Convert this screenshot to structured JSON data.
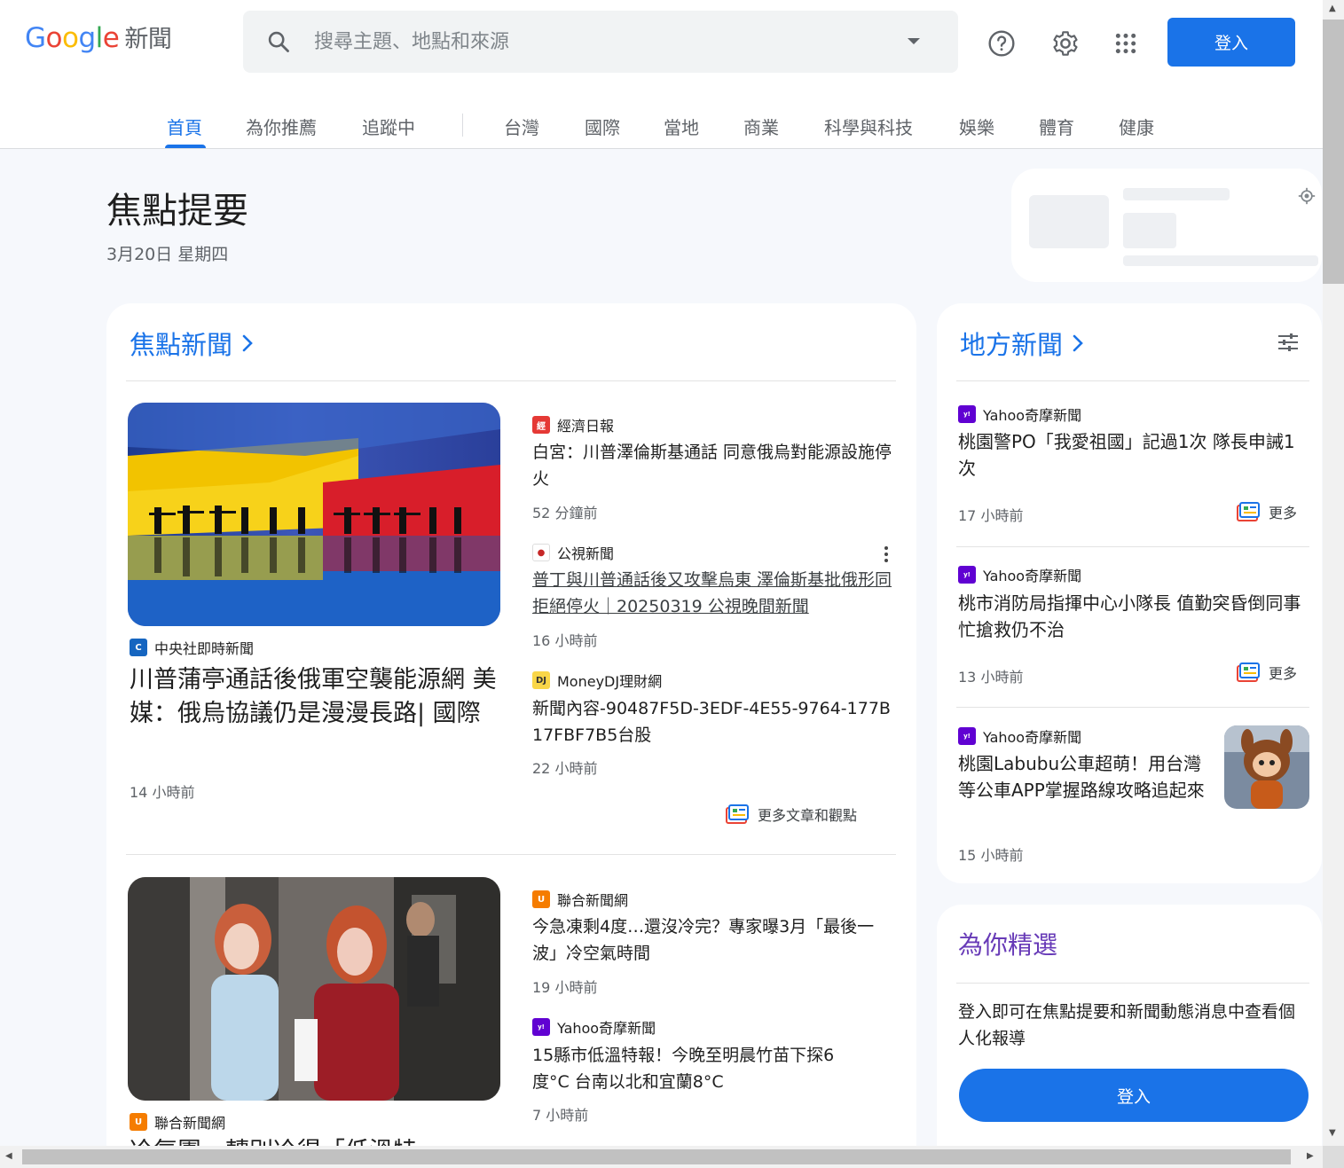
{
  "header": {
    "logo_letters": [
      "G",
      "o",
      "o",
      "g",
      "l",
      "e"
    ],
    "logo_suffix": "新聞",
    "search_placeholder": "搜尋主題、地點和來源",
    "login_label": "登入"
  },
  "nav": {
    "items": [
      {
        "label": "首頁",
        "active": true
      },
      {
        "label": "為你推薦"
      },
      {
        "label": "追蹤中"
      },
      {
        "label": "台灣"
      },
      {
        "label": "國際"
      },
      {
        "label": "當地"
      },
      {
        "label": "商業"
      },
      {
        "label": "科學與科技"
      },
      {
        "label": "娛樂"
      },
      {
        "label": "體育"
      },
      {
        "label": "健康"
      }
    ]
  },
  "briefing": {
    "title": "焦點提要",
    "date": "3月20日 星期四"
  },
  "top_stories": {
    "section_label": "焦點新聞",
    "cluster1": {
      "hero": {
        "source": "中央社即時新聞",
        "headline": "川普蒲亭通話後俄軍空襲能源網 美媒：俄烏協議仍是漫漫長路| 國際",
        "time": "14 小時前"
      },
      "articles": [
        {
          "source": "經濟日報",
          "headline": "白宮：川普澤倫斯基通話 同意俄烏對能源設施停火",
          "time": "52 分鐘前"
        },
        {
          "source": "公視新聞",
          "headline": "普丁與川普通話後又攻擊烏東 澤倫斯基批俄形同拒絕停火｜20250319 公視晚間新聞",
          "time": "16 小時前"
        },
        {
          "source": "MoneyDJ理財網",
          "headline": "新聞內容-90487F5D-3EDF-4E55-9764-177B17FBF7B5台股",
          "time": "22 小時前"
        }
      ],
      "more_label": "更多文章和觀點"
    },
    "cluster2": {
      "hero": {
        "source": "聯合新聞網",
        "headline": "冷氣團一轉別冷得「低溫特"
      },
      "articles": [
        {
          "source": "聯合新聞網",
          "headline": "今急凍剩4度…還沒冷完？專家曝3月「最後一波」冷空氣時間",
          "time": "19 小時前"
        },
        {
          "source": "Yahoo奇摩新聞",
          "headline": "15縣市低溫特報！今晚至明晨竹苗下探6度°C 台南以北和宜蘭8°C",
          "time": "7 小時前"
        }
      ]
    }
  },
  "local_news": {
    "section_label": "地方新聞",
    "items": [
      {
        "source": "Yahoo奇摩新聞",
        "headline": "桃園警PO「我愛祖國」記過1次 隊長申誡1次",
        "time": "17 小時前",
        "more_label": "更多"
      },
      {
        "source": "Yahoo奇摩新聞",
        "headline": "桃市消防局指揮中心小隊長 值勤突昏倒同事忙搶救仍不治",
        "time": "13 小時前",
        "more_label": "更多"
      },
      {
        "source": "Yahoo奇摩新聞",
        "headline": "桃園Labubu公車超萌！用台灣等公車APP掌握路線攻略追起來",
        "time": "15 小時前"
      }
    ]
  },
  "picks": {
    "title": "為你精選",
    "text": "登入即可在焦點提要和新聞動態消息中查看個人化報導",
    "login_label": "登入"
  },
  "colors": {
    "accent": "#1a73e8",
    "purple_title": "#673ab7"
  }
}
